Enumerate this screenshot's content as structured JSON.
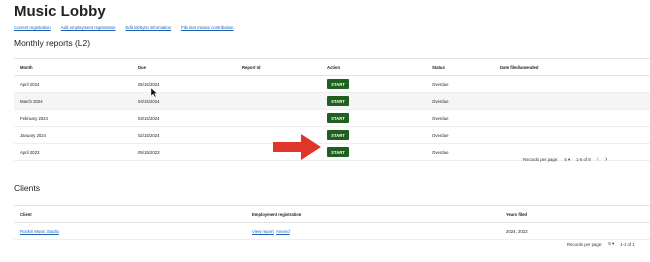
{
  "page": {
    "title": "Music Lobby"
  },
  "top_links": [
    "Current registration",
    "Add employment registration",
    "Edit lobbyist information",
    "File last minute contribution"
  ],
  "monthly": {
    "heading": "Monthly reports (L2)",
    "columns": [
      "Month",
      "Due",
      "Report Id",
      "Action",
      "Status",
      "Date filed/amended"
    ],
    "rows": [
      {
        "month": "April 2024",
        "due": "05/15/2024",
        "report_id": "",
        "action": "START",
        "status": "Overdue",
        "filed": ""
      },
      {
        "month": "March 2024",
        "due": "04/15/2024",
        "report_id": "",
        "action": "START",
        "status": "Overdue",
        "filed": ""
      },
      {
        "month": "February 2024",
        "due": "03/15/2024",
        "report_id": "",
        "action": "START",
        "status": "Overdue",
        "filed": ""
      },
      {
        "month": "January 2024",
        "due": "02/15/2024",
        "report_id": "",
        "action": "START",
        "status": "Overdue",
        "filed": ""
      },
      {
        "month": "April 2023",
        "due": "05/15/2023",
        "report_id": "",
        "action": "START",
        "status": "Overdue",
        "filed": ""
      }
    ],
    "pager": {
      "label": "Records per page:",
      "per_page": "5",
      "range": "1-5 of 8",
      "prev": "‹",
      "next": "›",
      "dropdown": "▾"
    }
  },
  "clients": {
    "heading": "Clients",
    "columns": [
      "Client",
      "Employment registration",
      "Years filed"
    ],
    "rows": [
      {
        "client": "Rockin Music Studio",
        "view": "View report",
        "amend": "Amend",
        "years": "2024, 2023"
      }
    ],
    "pager": {
      "label": "Records per page:",
      "per_page": "5",
      "range": "1-1 of 1",
      "dropdown": "▾"
    }
  },
  "colors": {
    "start_button": "#1f5f1f",
    "arrow": "#e0352b",
    "link": "#1a5fb4"
  }
}
